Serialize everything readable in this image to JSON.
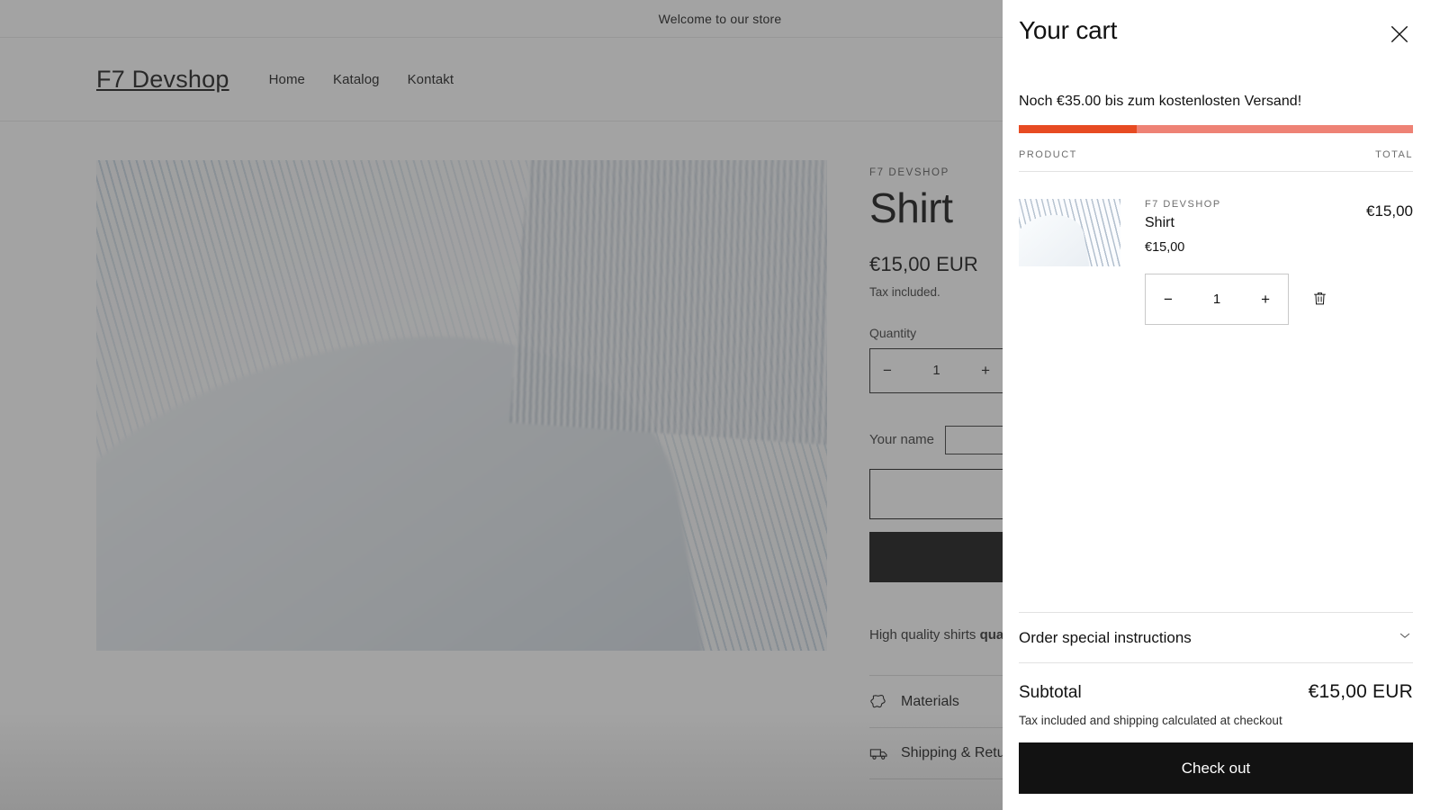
{
  "announcement": {
    "text": "Welcome to our store"
  },
  "header": {
    "brand": "F7 Devshop",
    "nav": [
      {
        "label": "Home"
      },
      {
        "label": "Katalog"
      },
      {
        "label": "Kontakt"
      }
    ]
  },
  "product": {
    "vendor": "F7 DEVSHOP",
    "title": "Shirt",
    "price": "€15,00 EUR",
    "tax_note": "Tax included.",
    "quantity_label": "Quantity",
    "quantity_value": "1",
    "decrease_label": "−",
    "increase_label": "+",
    "name_field_label": "Your name",
    "name_field_value": "",
    "name_field_placeholder": "",
    "add_to_cart_label": "",
    "buy_now_label": "",
    "description_lead": "High quality shirts",
    "description_bold": "quality, pre-shrunk",
    "collapsibles": [
      {
        "label": "Materials",
        "icon": "hide-leather-icon"
      },
      {
        "label": "Shipping & Returns",
        "icon": "truck-icon"
      }
    ]
  },
  "cart": {
    "title": "Your cart",
    "close_icon": "close-icon",
    "free_shipping_message": "Noch €35.00 bis zum kostenlosten Versand!",
    "progress_percent": 30,
    "progress_fill_color": "#e74b22",
    "progress_track_color": "#ee8275",
    "columns": {
      "product": "PRODUCT",
      "total": "TOTAL"
    },
    "items": [
      {
        "vendor": "F7 DEVSHOP",
        "name": "Shirt",
        "price": "€15,00",
        "line_total": "€15,00",
        "quantity": "1",
        "decrease_label": "−",
        "increase_label": "+",
        "remove_icon": "trash-icon"
      }
    ],
    "special_instructions_label": "Order special instructions",
    "special_instructions_icon": "chevron-down-icon",
    "subtotal_label": "Subtotal",
    "subtotal_value": "€15,00 EUR",
    "checkout_note": "Tax included and shipping calculated at checkout",
    "checkout_label": "Check out"
  }
}
